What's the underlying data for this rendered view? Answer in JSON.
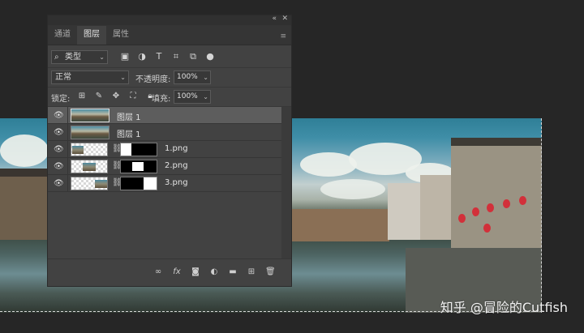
{
  "panel": {
    "topbar": {
      "collapse": "«",
      "close": "✕"
    },
    "tabs": [
      {
        "label": "通道"
      },
      {
        "label": "图层"
      },
      {
        "label": "属性"
      }
    ],
    "menu_icon": "≡",
    "filter": {
      "kind": "类型",
      "icons": [
        "image-filter-icon",
        "adjustment-filter-icon",
        "text-filter-icon",
        "shape-filter-icon",
        "smart-object-filter-icon",
        "filter-toggle-icon"
      ]
    },
    "blend": {
      "mode": "正常",
      "opacity_label": "不透明度:",
      "opacity": "100%"
    },
    "lock": {
      "label": "锁定:",
      "fill_label": "填充:",
      "fill": "100%"
    },
    "layers": [
      {
        "name": "图层 1",
        "selected": true,
        "visible": true
      },
      {
        "name": "图层 1",
        "selected": false,
        "visible": true
      },
      {
        "name": "1.png",
        "selected": false,
        "visible": true
      },
      {
        "name": "2.png",
        "selected": false,
        "visible": true
      },
      {
        "name": "3.png",
        "selected": false,
        "visible": true
      }
    ],
    "bottom_icons": [
      "link-layers-icon",
      "fx-icon",
      "add-mask-icon",
      "adjustment-layer-icon",
      "group-folder-icon",
      "new-layer-icon",
      "delete-icon"
    ]
  },
  "watermark": "知乎 @冒险的Cutfish",
  "colors": {
    "panel_bg": "#424242",
    "selected_layer": "#5d5d5d",
    "workspace": "#262626"
  }
}
